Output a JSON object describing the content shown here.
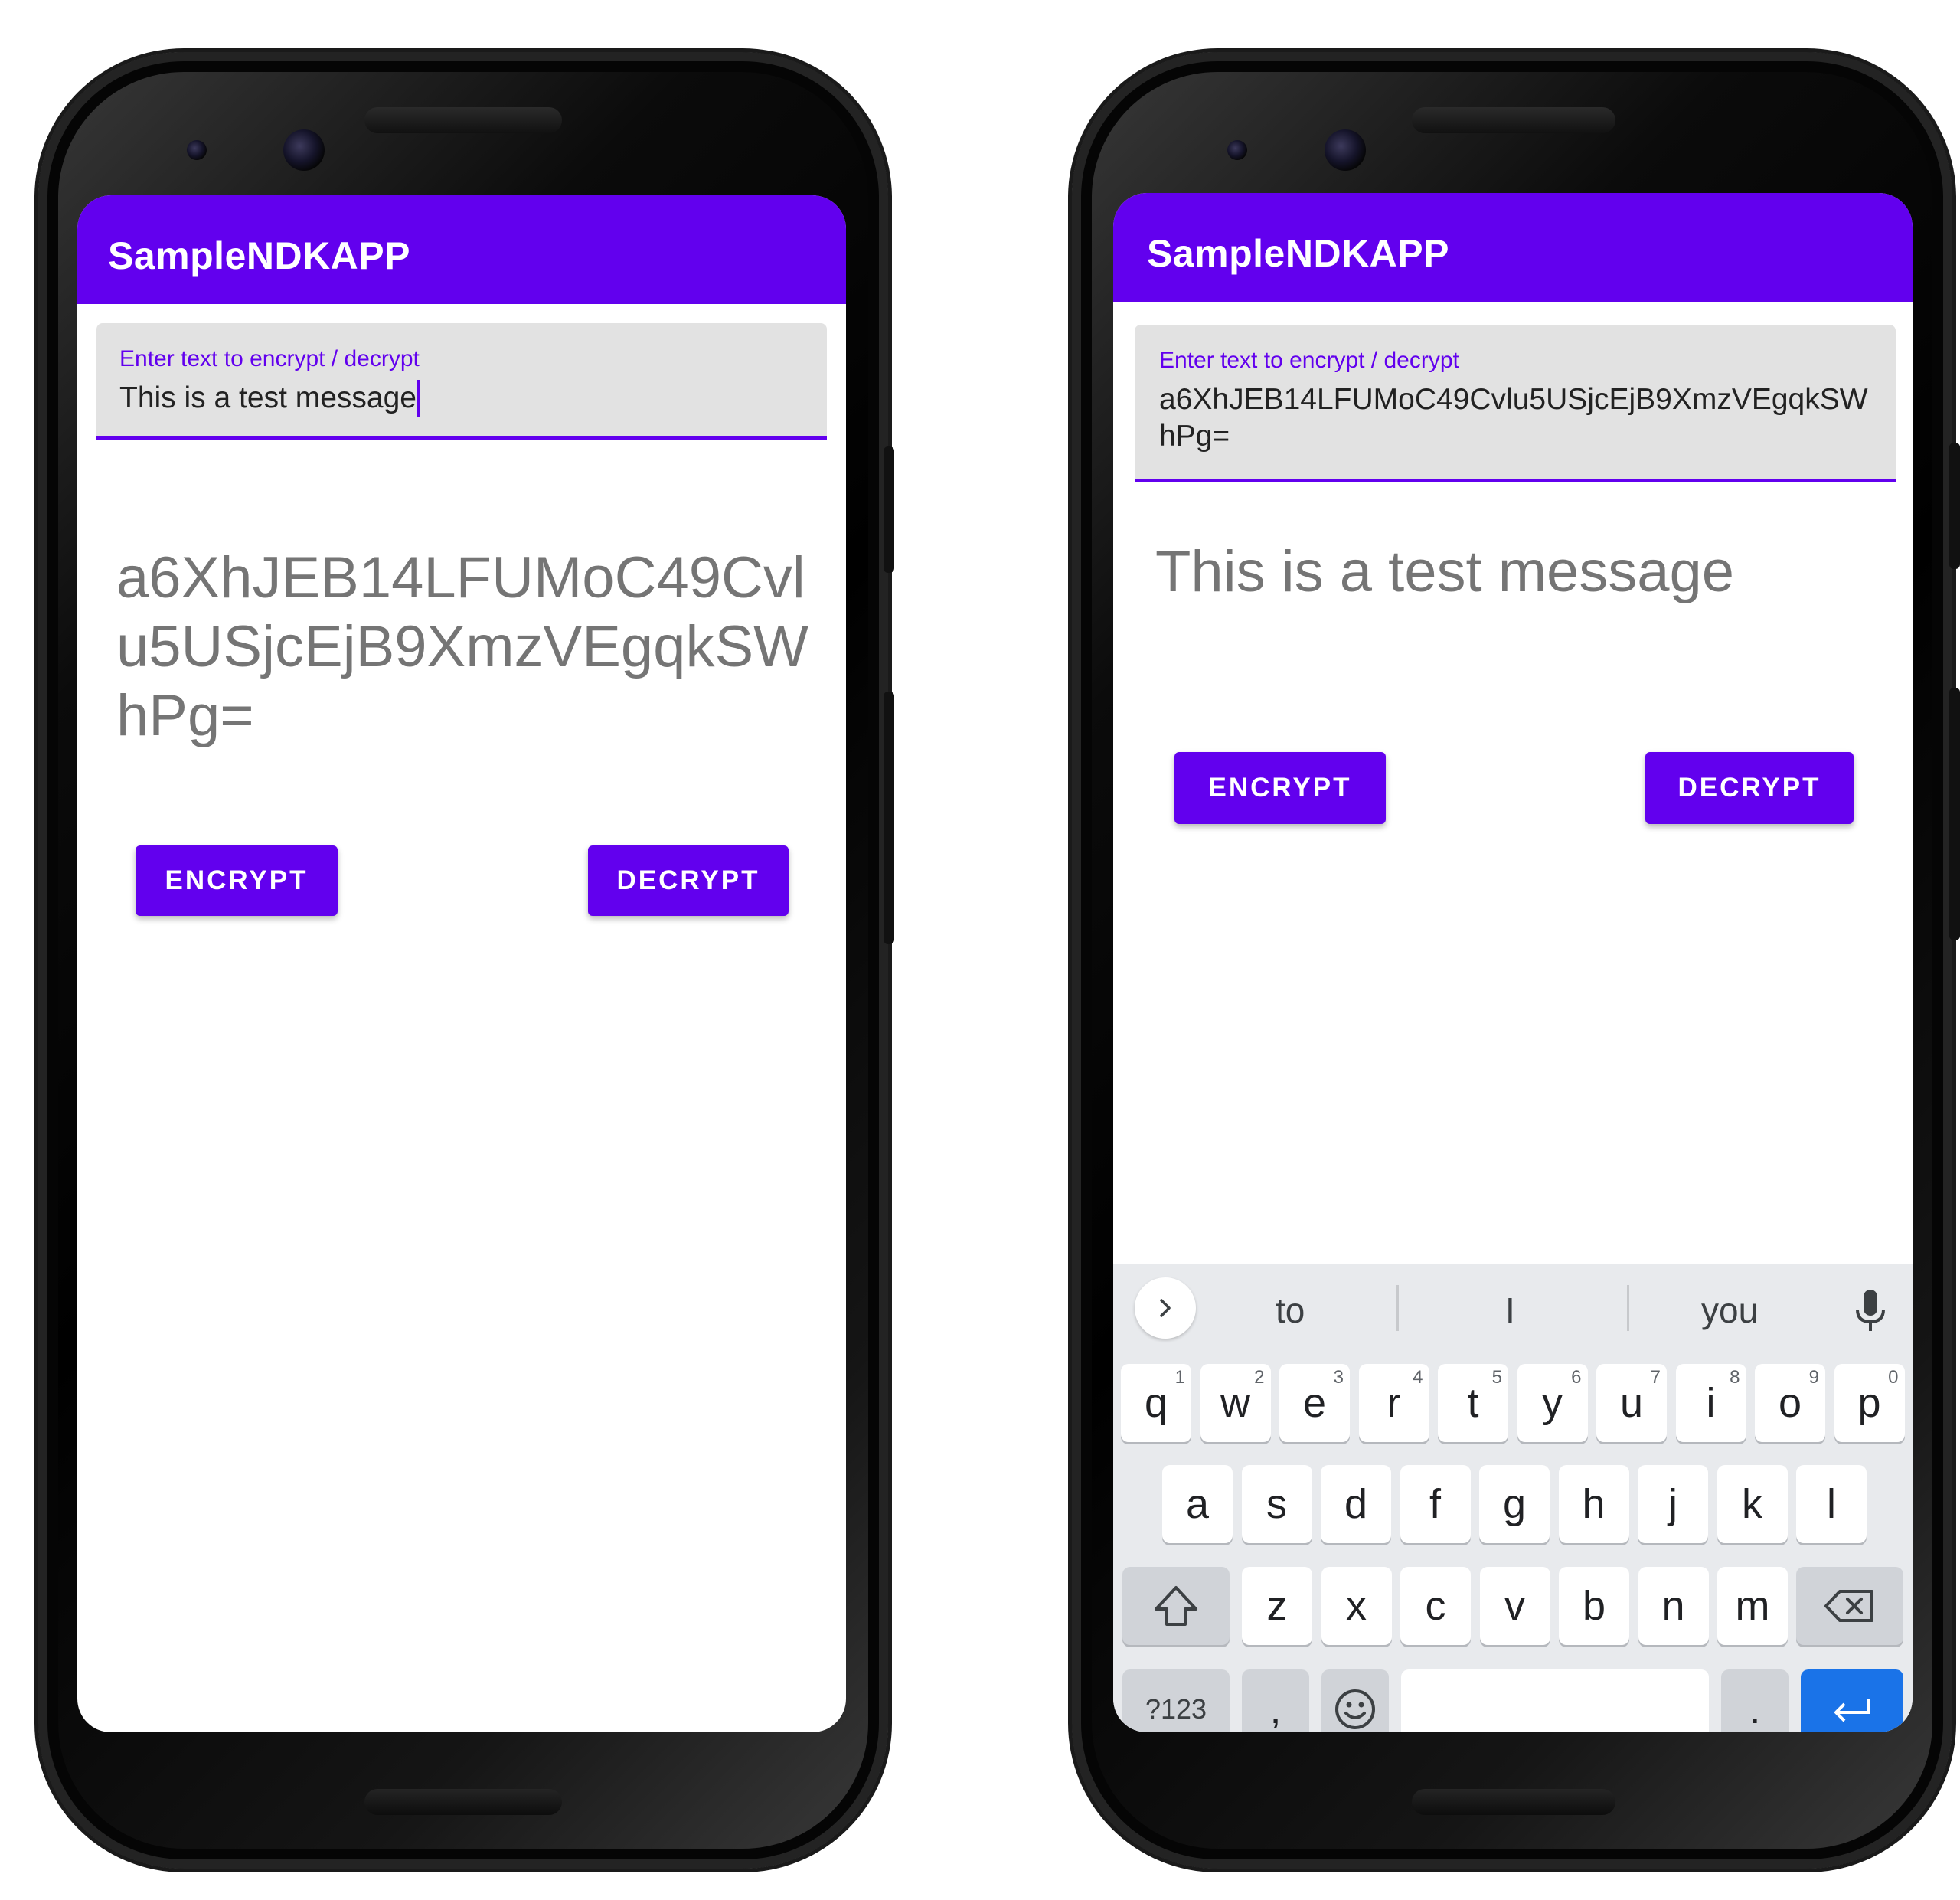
{
  "left": {
    "app_title": "SampleNDKAPP",
    "input_label": "Enter text to encrypt / decrypt",
    "input_value": "This is a test message",
    "output_text": "a6XhJEB14LFUMoC49Cvlu5USjcEjB9XmzVEgqkSWhPg=",
    "encrypt_label": "ENCRYPT",
    "decrypt_label": "DECRYPT"
  },
  "right": {
    "app_title": "SampleNDKAPP",
    "input_label": "Enter text to encrypt / decrypt",
    "input_value": "a6XhJEB14LFUMoC49Cvlu5USjcEjB9XmzVEgqkSWhPg=",
    "output_text": "This is a test message",
    "encrypt_label": "ENCRYPT",
    "decrypt_label": "DECRYPT",
    "keyboard": {
      "suggestions": [
        "to",
        "I",
        "you"
      ],
      "row1": [
        {
          "key": "q",
          "hint": "1"
        },
        {
          "key": "w",
          "hint": "2"
        },
        {
          "key": "e",
          "hint": "3"
        },
        {
          "key": "r",
          "hint": "4"
        },
        {
          "key": "t",
          "hint": "5"
        },
        {
          "key": "y",
          "hint": "6"
        },
        {
          "key": "u",
          "hint": "7"
        },
        {
          "key": "i",
          "hint": "8"
        },
        {
          "key": "o",
          "hint": "9"
        },
        {
          "key": "p",
          "hint": "0"
        }
      ],
      "row2": [
        "a",
        "s",
        "d",
        "f",
        "g",
        "h",
        "j",
        "k",
        "l"
      ],
      "row3": [
        "z",
        "x",
        "c",
        "v",
        "b",
        "n",
        "m"
      ],
      "symbols_label": "?123",
      "comma_label": ",",
      "period_label": "."
    }
  },
  "colors": {
    "primary": "#6200ee",
    "output_text": "#757575",
    "enter_key": "#1a73e8",
    "keyboard_bg": "#e8eaed"
  },
  "icons": [
    "chevron-right-icon",
    "mic-icon",
    "shift-icon",
    "backspace-icon",
    "emoji-icon",
    "enter-icon"
  ]
}
